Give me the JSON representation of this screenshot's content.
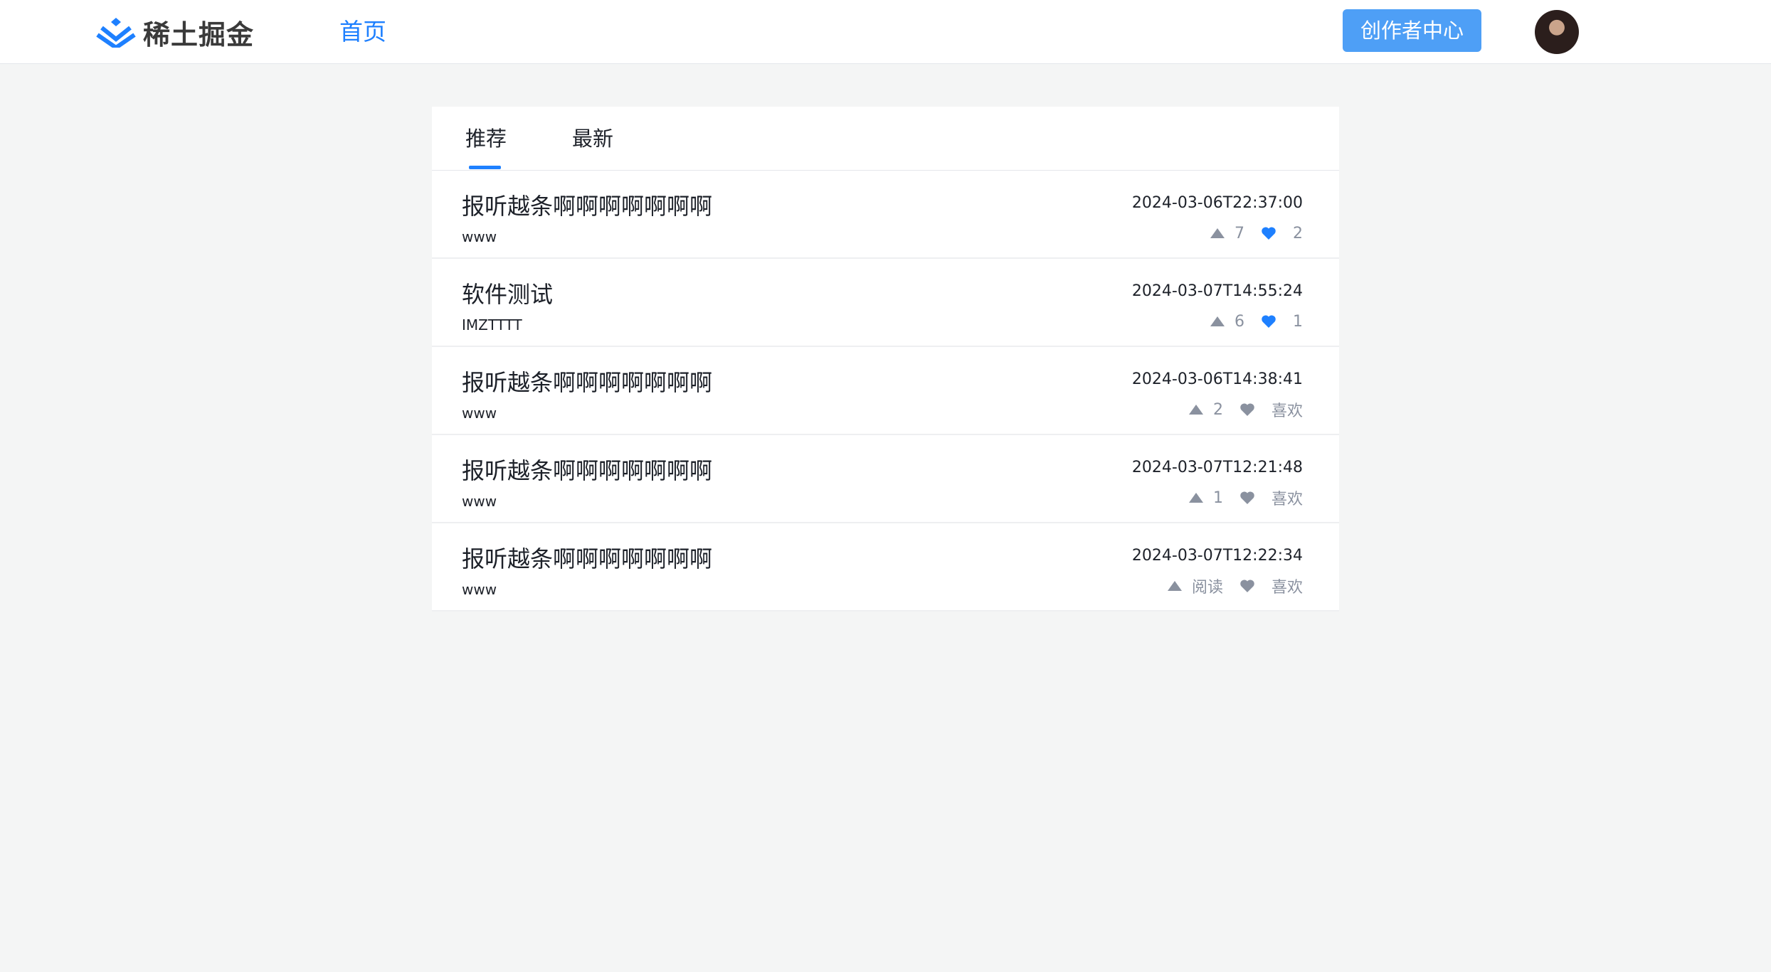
{
  "header": {
    "logo_text": "稀土掘金",
    "nav_home": "首页",
    "creator_button": "创作者中心"
  },
  "colors": {
    "accent": "#1e80ff",
    "button": "#4e9ff6",
    "liked_heart": "#1e80ff",
    "muted": "#8a919f"
  },
  "tabs": [
    {
      "label": "推荐",
      "active": true
    },
    {
      "label": "最新",
      "active": false
    }
  ],
  "articles": [
    {
      "title": "报听越条啊啊啊啊啊啊啊",
      "author": "www",
      "date": "2024-03-06T22:37:00",
      "views": "7",
      "likes": "2",
      "liked": true
    },
    {
      "title": "软件测试",
      "author": "IMZTTTT",
      "date": "2024-03-07T14:55:24",
      "views": "6",
      "likes": "1",
      "liked": true
    },
    {
      "title": "报听越条啊啊啊啊啊啊啊",
      "author": "www",
      "date": "2024-03-06T14:38:41",
      "views": "2",
      "likes": "喜欢",
      "liked": false
    },
    {
      "title": "报听越条啊啊啊啊啊啊啊",
      "author": "www",
      "date": "2024-03-07T12:21:48",
      "views": "1",
      "likes": "喜欢",
      "liked": false
    },
    {
      "title": "报听越条啊啊啊啊啊啊啊",
      "author": "www",
      "date": "2024-03-07T12:22:34",
      "views": "阅读",
      "likes": "喜欢",
      "liked": false
    }
  ]
}
